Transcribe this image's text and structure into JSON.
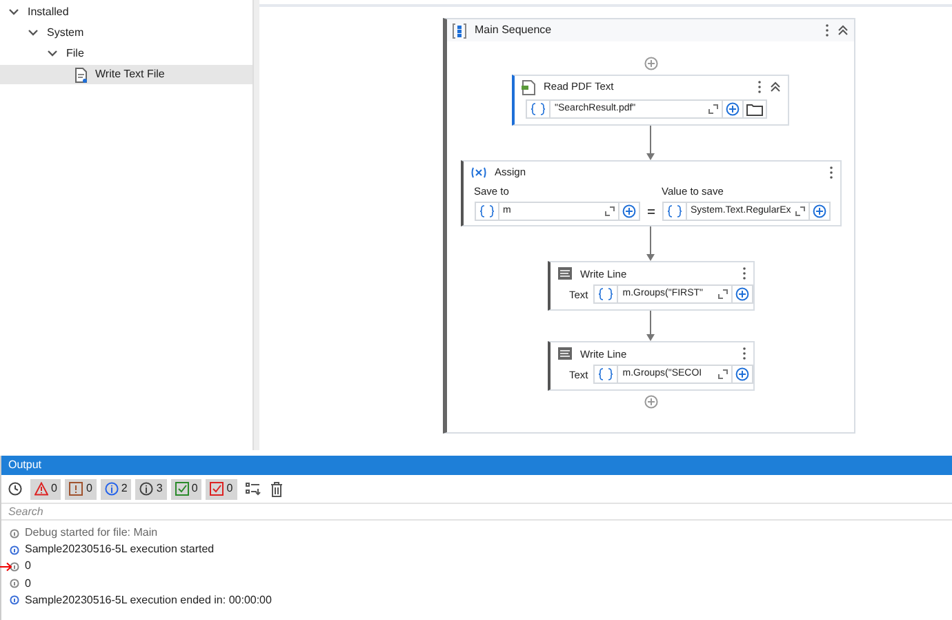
{
  "tree": [
    {
      "label": "Installed",
      "expanded": true,
      "children": [
        {
          "label": "System",
          "expanded": true,
          "children": [
            {
              "label": "File",
              "expanded": true,
              "children": [
                {
                  "label": "Write Text File",
                  "selected": true
                }
              ]
            }
          ]
        }
      ]
    }
  ],
  "sequence": {
    "title": "Main Sequence",
    "activities": [
      {
        "kind": "read_pdf",
        "title": "Read PDF Text",
        "value": "\"SearchResult.pdf\""
      },
      {
        "kind": "assign",
        "title": "Assign",
        "save_label": "Save to",
        "save_value": "m",
        "value_label": "Value to save",
        "value": "System.Text.RegularEx"
      },
      {
        "kind": "write_line",
        "title": "Write Line",
        "field_label": "Text",
        "value": "m.Groups(\"FIRST\""
      },
      {
        "kind": "write_line",
        "title": "Write Line",
        "field_label": "Text",
        "value": "m.Groups(\"SECOI"
      }
    ]
  },
  "output": {
    "title": "Output",
    "filters": [
      {
        "kind": "error",
        "count": "0",
        "selected": true
      },
      {
        "kind": "warning",
        "count": "0",
        "selected": true
      },
      {
        "kind": "info",
        "count": "2",
        "selected": true
      },
      {
        "kind": "trace",
        "count": "3",
        "selected": true
      },
      {
        "kind": "success",
        "count": "0",
        "selected": true
      },
      {
        "kind": "failure",
        "count": "0",
        "selected": true
      }
    ],
    "search": {
      "placeholder": "Search"
    },
    "entries": [
      {
        "kind": "trace",
        "text": "Debug started for file: Main",
        "marked": false
      },
      {
        "kind": "info",
        "text": "Sample20230516-5L execution started",
        "marked": false
      },
      {
        "kind": "trace",
        "text": "0",
        "marked": true
      },
      {
        "kind": "trace",
        "text": "0",
        "marked": false
      },
      {
        "kind": "info",
        "text": "Sample20230516-5L execution ended in: 00:00:00",
        "marked": false
      }
    ]
  }
}
